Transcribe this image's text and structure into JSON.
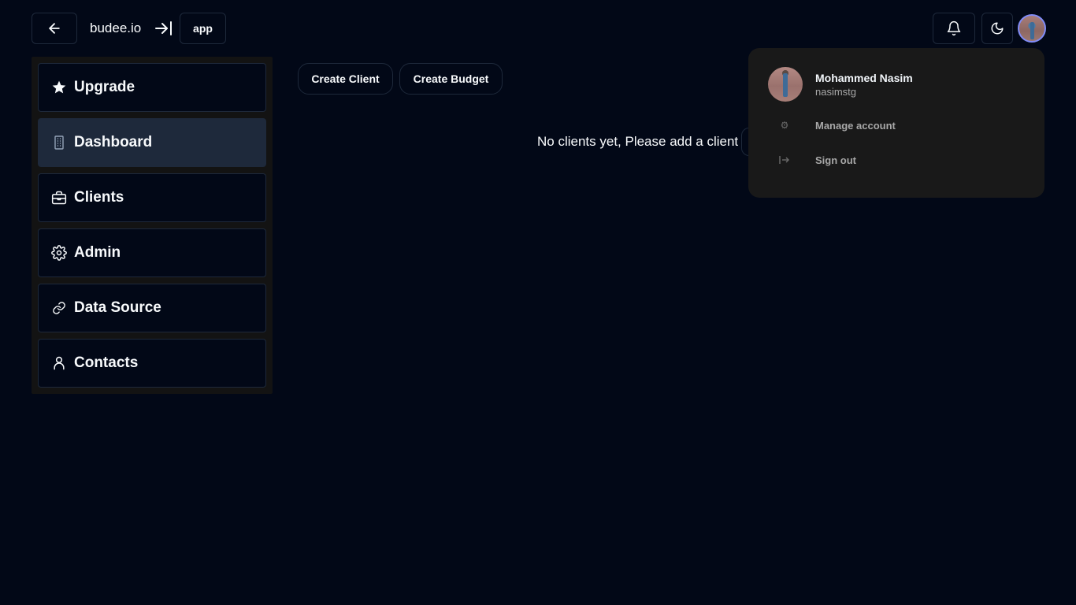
{
  "header": {
    "brand": "budee.io",
    "app_label": "app",
    "back_icon": "arrow-left-icon",
    "collapse_icon": "arrow-right-to-line-icon",
    "bell_icon": "bell-icon",
    "theme_icon": "moon-icon"
  },
  "sidebar": {
    "items": [
      {
        "label": "Upgrade",
        "icon": "star-icon",
        "active": false
      },
      {
        "label": "Dashboard",
        "icon": "building-icon",
        "active": true
      },
      {
        "label": "Clients",
        "icon": "briefcase-icon",
        "active": false
      },
      {
        "label": "Admin",
        "icon": "gear-icon",
        "active": false
      },
      {
        "label": "Data Source",
        "icon": "link-icon",
        "active": false
      },
      {
        "label": "Contacts",
        "icon": "user-icon",
        "active": false
      }
    ]
  },
  "main": {
    "create_client": "Create Client",
    "create_budget": "Create Budget",
    "empty_message": "No clients yet, Please add a client"
  },
  "user_menu": {
    "name": "Mohammed Nasim",
    "username": "nasimstg",
    "manage_account": "Manage account",
    "sign_out": "Sign out"
  },
  "colors": {
    "background": "#020817",
    "border": "#1e293b",
    "active_item": "#1e293b",
    "dropdown_bg": "#191919",
    "avatar_ring": "#818cf8"
  }
}
